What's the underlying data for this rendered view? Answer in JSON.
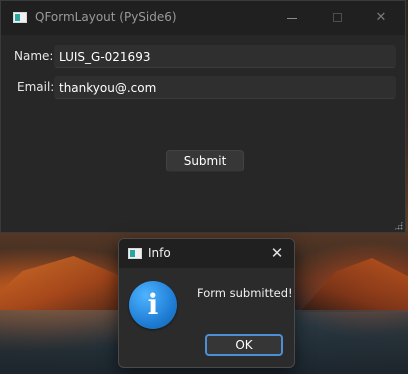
{
  "main_window": {
    "title": "QFormLayout (PySide6)",
    "form": {
      "name_label": "Name:",
      "name_value": "LUIS_G-021693",
      "email_label": "Email:",
      "email_value": "thankyou@.com"
    },
    "submit_label": "Submit",
    "controls": {
      "minimize": "minimize-icon",
      "maximize": "maximize-icon",
      "close": "close-icon"
    }
  },
  "message_box": {
    "title": "Info",
    "icon": "info-icon",
    "info_glyph": "i",
    "close_glyph": "✕",
    "message": "Form submitted!",
    "ok_label": "OK"
  },
  "colors": {
    "window_bg": "#272727",
    "titlebar_bg": "#202020",
    "accent": "#4b8fd6",
    "info_blue": "#1f7fd6"
  }
}
